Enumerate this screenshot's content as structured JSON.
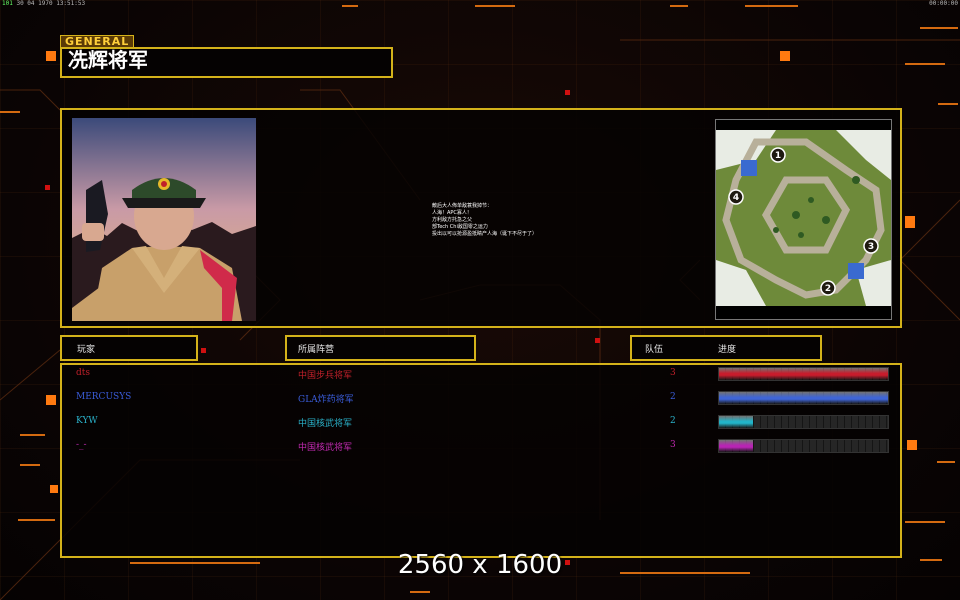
{
  "top_status": {
    "left_prefix": "101",
    "left_text": "30 04 1970 13:51:53",
    "right_text": "00:00:00"
  },
  "header": {
    "tag": "GENERAL",
    "title": "冼辉将军"
  },
  "briefing": {
    "lines": [
      "敵后大人佈单敌蓑我掉节：",
      "人海！APC寡人！",
      "方利敌方托急之父",
      "部Tech Chi敌国零之运力",
      "投出以可以抢源盈抵睛产人海（诞下不尽于了）"
    ]
  },
  "minimap": {
    "markers": [
      "1",
      "2",
      "3",
      "4"
    ]
  },
  "columns": {
    "player": "玩家",
    "faction": "所属阵营",
    "team": "队伍",
    "progress": "进度"
  },
  "players": [
    {
      "name": "dts",
      "faction": "中国步兵将军",
      "team": "3",
      "progress": 1.0,
      "color": "#c0202a",
      "bar_color": "#c81c2c"
    },
    {
      "name": "MERCUSYS",
      "faction": "GLA炸药将军",
      "team": "2",
      "progress": 1.0,
      "color": "#3a5cd8",
      "bar_color": "#3f65d6"
    },
    {
      "name": "KYW",
      "faction": "中国核武将军",
      "team": "2",
      "progress": 0.2,
      "color": "#2ab0c8",
      "bar_color": "#22b4c8"
    },
    {
      "name": "-_-",
      "faction": "中国核武将军",
      "team": "3",
      "progress": 0.2,
      "color": "#c02ab0",
      "bar_color": "#b824b4"
    }
  ],
  "footer": {
    "resolution": "2560 x 1600"
  },
  "colors": {
    "frame": "#d4b21a",
    "accent_orange": "#ff6a00"
  }
}
